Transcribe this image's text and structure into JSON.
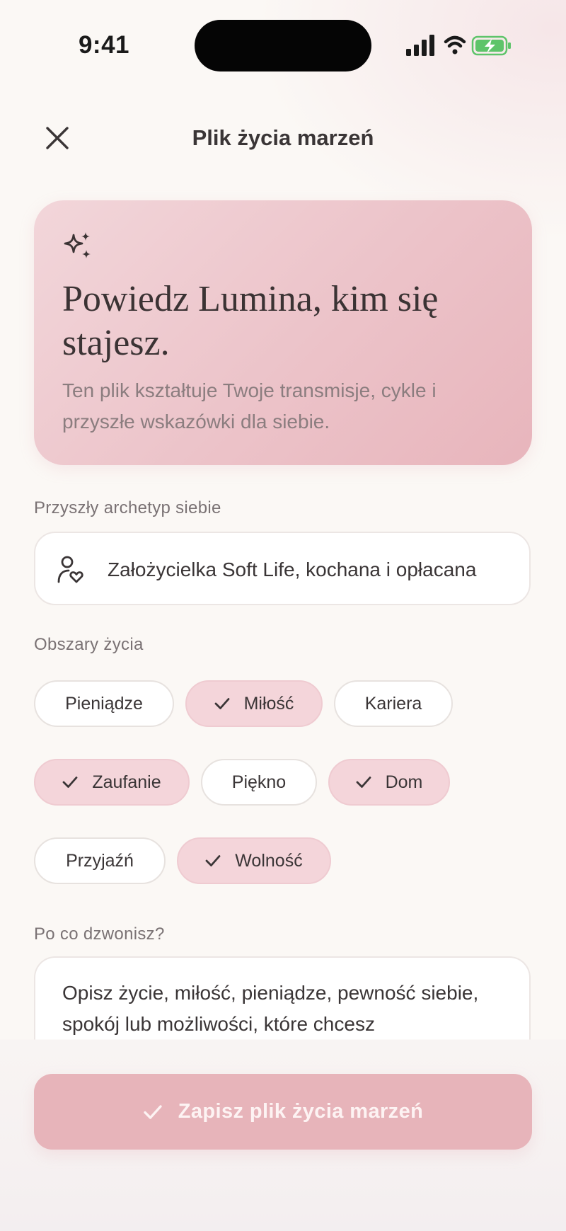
{
  "status_bar": {
    "time": "9:41",
    "icons": [
      "cellular-signal-icon",
      "wifi-icon",
      "battery-charging-icon"
    ]
  },
  "header": {
    "title": "Plik życia marzeń",
    "close_icon": "close-icon"
  },
  "hero": {
    "icon": "sparkles-icon",
    "heading": "Powiedz Lumina, kim się stajesz.",
    "subtitle": "Ten plik kształtuje Twoje transmisje, cykle i przyszłe wskazówki dla siebie."
  },
  "archetype": {
    "label": "Przyszły archetyp siebie",
    "icon": "person-heart-icon",
    "value": "Założycielka Soft Life, kochana i opłacana"
  },
  "life_areas": {
    "label": "Obszary życia",
    "chips": [
      {
        "label": "Pieniądze",
        "selected": false
      },
      {
        "label": "Miłość",
        "selected": true
      },
      {
        "label": "Kariera",
        "selected": false
      },
      {
        "label": "Zaufanie",
        "selected": true
      },
      {
        "label": "Piękno",
        "selected": false
      },
      {
        "label": "Dom",
        "selected": true
      },
      {
        "label": "Przyjaźń",
        "selected": false
      },
      {
        "label": "Wolność",
        "selected": true
      }
    ]
  },
  "calling": {
    "label": "Po co dzwonisz?",
    "placeholder": "Opisz życie, miłość, pieniądze, pewność siebie, spokój lub możliwości, które chcesz"
  },
  "save_button": {
    "label": "Zapisz plik życia marzeń",
    "icon": "check-icon"
  },
  "colors": {
    "background": "#fbf8f5",
    "hero_card": "#ecc3c9",
    "chip_selected": "#f4d5da",
    "button": "#e7b4ba",
    "text": "#3a3536",
    "muted": "#7a7274"
  }
}
